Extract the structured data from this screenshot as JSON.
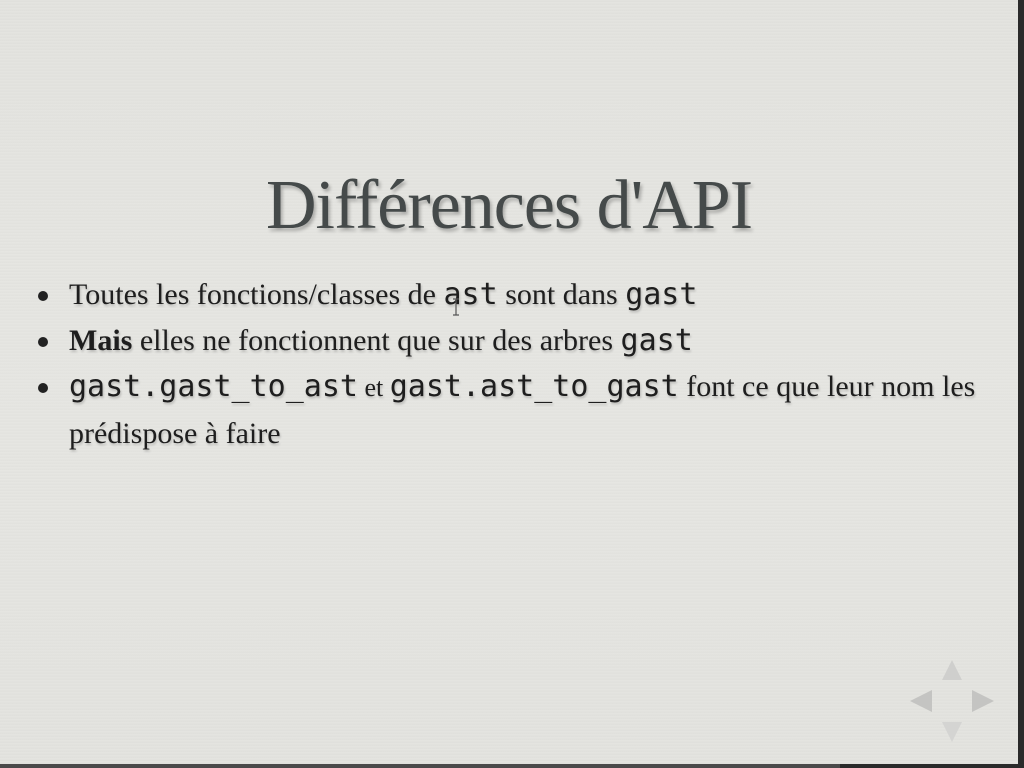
{
  "slide": {
    "title": "Différences d'API",
    "bullets": [
      {
        "parts": [
          "Toutes les fonctions/classes de ",
          "ast",
          " sont dans ",
          "gast"
        ]
      },
      {
        "parts": [
          "Mais",
          " elles ne fonctionnent que sur des arbres ",
          "gast"
        ]
      },
      {
        "parts": [
          "gast.gast_to_ast",
          " et ",
          "gast.ast_to_gast",
          " font ce que leur nom les prédispose à faire"
        ]
      }
    ]
  },
  "nav": {
    "icons": [
      "up-arrow-icon",
      "left-arrow-icon",
      "right-arrow-icon",
      "down-arrow-icon"
    ]
  },
  "progress": 0.82,
  "colors": {
    "background": "#e4e4e0",
    "title": "#454a4a",
    "text": "#1e1e1e",
    "nav_arrows": "#c8c8c6"
  }
}
